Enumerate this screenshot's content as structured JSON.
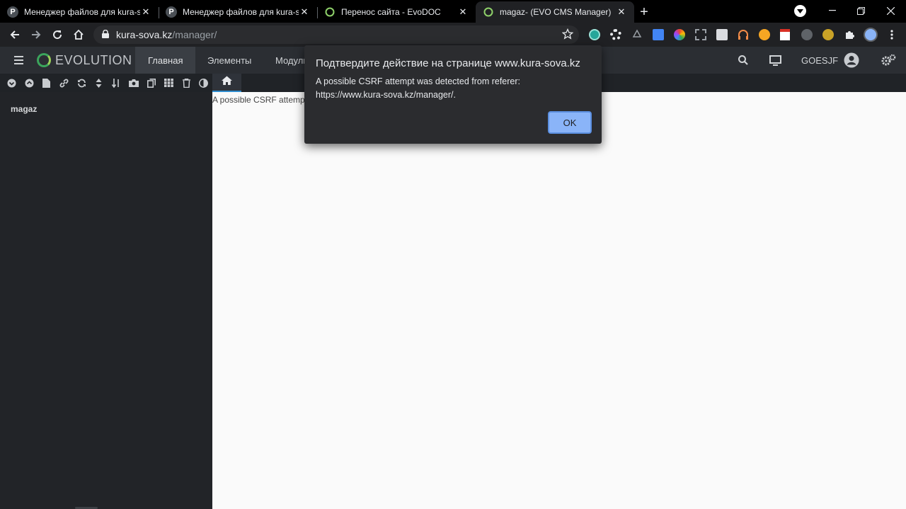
{
  "browser": {
    "tabs": [
      {
        "title": "Менеджер файлов для kura-sov",
        "favicon": "p-circle-icon",
        "active": false
      },
      {
        "title": "Менеджер файлов для kura-sov",
        "favicon": "p-circle-icon",
        "active": false
      },
      {
        "title": "Перенос сайта - EvoDOC",
        "favicon": "evo-ring-icon",
        "active": false
      },
      {
        "title": "magaz- (EVO CMS Manager)",
        "favicon": "evo-ring-icon",
        "active": true
      }
    ],
    "favicon_letter": "P",
    "close_glyph": "✕",
    "new_tab_glyph": "+",
    "url_host": "kura-sova.kz",
    "url_path": "/manager/"
  },
  "evo": {
    "logo_text": "EVOLUTION",
    "menu": [
      "Главная",
      "Элементы",
      "Модули"
    ],
    "username": "GOESJF",
    "tree_root": "magaz",
    "content_text": "A possible CSRF attemp",
    "accent_color": "#2f8dd0",
    "logo_color": "#3ba55c"
  },
  "dialog": {
    "title": "Подтвердите действие на странице www.kura-sova.kz",
    "message": "A possible CSRF attempt was detected from referer: https://www.kura-sova.kz/manager/.",
    "ok_label": "OK",
    "button_color": "#8ab4f8"
  }
}
